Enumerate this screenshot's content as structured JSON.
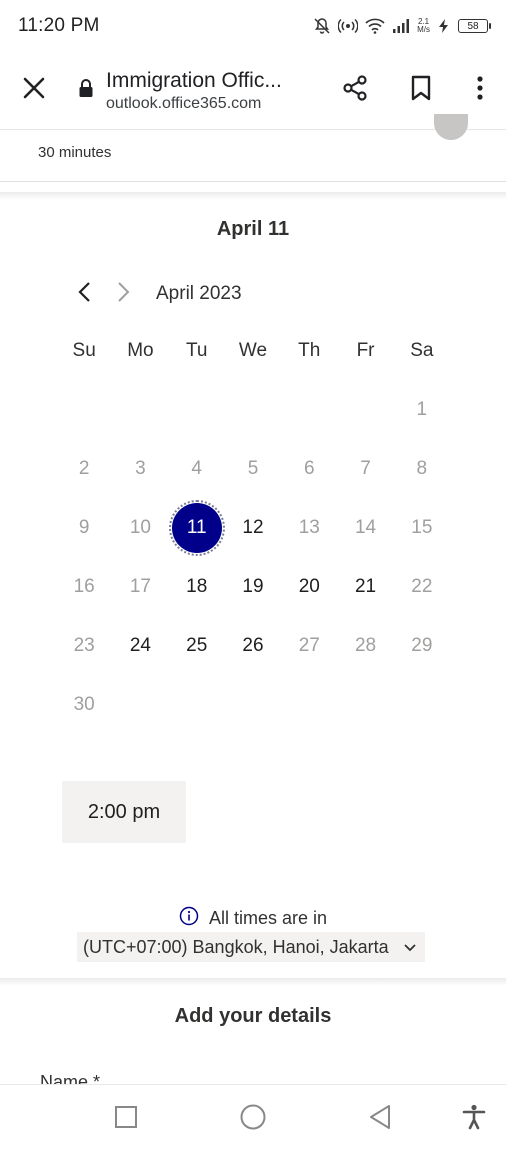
{
  "status_bar": {
    "time": "11:20 PM",
    "net_speed_value": "2.1",
    "net_speed_unit": "M/s",
    "battery": "58",
    "icons": [
      "bell-off-icon",
      "hotspot-icon",
      "wifi-icon",
      "signal-icon",
      "charging-icon",
      "battery-icon"
    ]
  },
  "browser": {
    "title": "Immigration Offic...",
    "url": "outlook.office365.com",
    "icons": [
      "close-icon",
      "lock-icon",
      "share-icon",
      "bookmark-icon",
      "more-vert-icon"
    ]
  },
  "service": {
    "duration": "30 minutes"
  },
  "booking": {
    "selected_date_heading": "April 11",
    "month_label": "April 2023",
    "weekdays": [
      "Su",
      "Mo",
      "Tu",
      "We",
      "Th",
      "Fr",
      "Sa"
    ],
    "weeks": [
      [
        "",
        "",
        "",
        "",
        "",
        "",
        "1"
      ],
      [
        "2",
        "3",
        "4",
        "5",
        "6",
        "7",
        "8"
      ],
      [
        "9",
        "10",
        "11",
        "12",
        "13",
        "14",
        "15"
      ],
      [
        "16",
        "17",
        "18",
        "19",
        "20",
        "21",
        "22"
      ],
      [
        "23",
        "24",
        "25",
        "26",
        "27",
        "28",
        "29"
      ],
      [
        "30",
        "",
        "",
        "",
        "",
        "",
        ""
      ]
    ],
    "available_days": [
      "11",
      "12",
      "18",
      "19",
      "20",
      "21",
      "24",
      "25",
      "26"
    ],
    "selected_day": "11",
    "time_slots": [
      "2:00 pm"
    ],
    "timezone_note": "All times are in",
    "timezone_value": "(UTC+07:00) Bangkok, Hanoi, Jakarta"
  },
  "details": {
    "heading": "Add your details",
    "name_label": "Name *"
  },
  "colors": {
    "selected_day": "#00008b",
    "slot_background": "#f3f2f1",
    "unavailable_text": "#a19f9d"
  },
  "system_nav": [
    "recents-icon",
    "home-icon",
    "back-icon",
    "accessibility-icon"
  ]
}
